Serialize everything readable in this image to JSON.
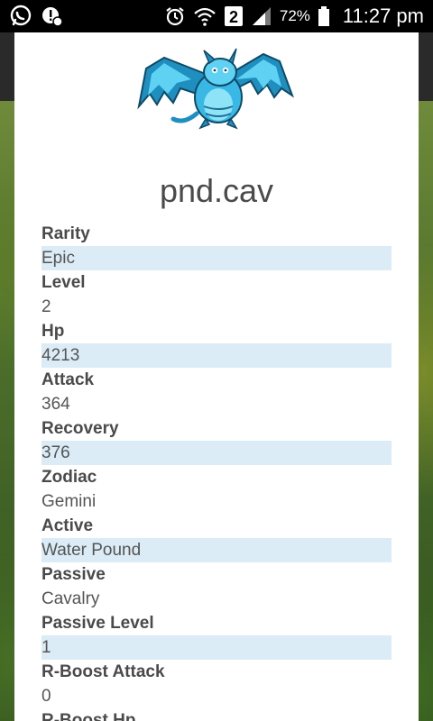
{
  "status_bar": {
    "battery": "72%",
    "time": "11:27 pm",
    "sim_label": "2",
    "icons": [
      "whatsapp-icon",
      "notification-icon",
      "alarm-icon",
      "wifi-icon",
      "sim-icon",
      "signal-icon",
      "battery-icon"
    ]
  },
  "monster": {
    "name": "pnd.cav",
    "image": "blue-dragon-icon"
  },
  "stats": [
    {
      "label": "Rarity",
      "value": "Epic",
      "highlight": true
    },
    {
      "label": "Level",
      "value": "2",
      "highlight": false
    },
    {
      "label": "Hp",
      "value": "4213",
      "highlight": true
    },
    {
      "label": "Attack",
      "value": "364",
      "highlight": false
    },
    {
      "label": "Recovery",
      "value": "376",
      "highlight": true
    },
    {
      "label": "Zodiac",
      "value": "Gemini",
      "highlight": false
    },
    {
      "label": "Active",
      "value": "Water Pound",
      "highlight": true
    },
    {
      "label": "Passive",
      "value": "Cavalry",
      "highlight": false
    },
    {
      "label": "Passive Level",
      "value": "1",
      "highlight": true
    },
    {
      "label": "R-Boost Attack",
      "value": "0",
      "highlight": false
    },
    {
      "label": "R-Boost Hp",
      "value": "",
      "highlight": true
    }
  ],
  "colors": {
    "highlight": "#dbecf6",
    "text": "#4a4a4a",
    "dragon_primary": "#39b8e6"
  }
}
